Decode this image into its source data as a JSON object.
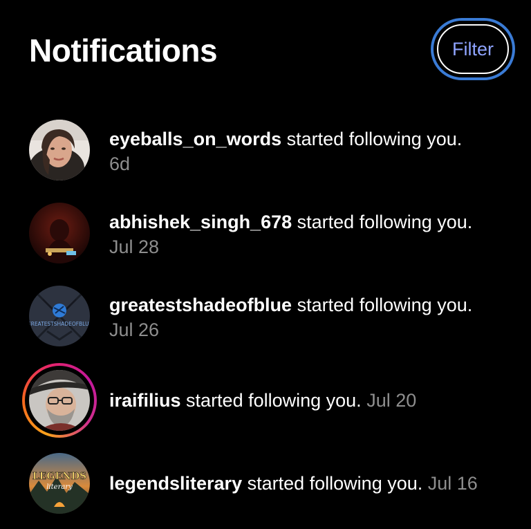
{
  "header": {
    "title": "Notifications",
    "filter_label": "Filter"
  },
  "notifications": [
    {
      "username": "eyeballs_on_words",
      "message": "started following you.",
      "time": "6d",
      "avatar": "woman-portrait-avatar"
    },
    {
      "username": "abhishek_singh_678",
      "message": "started following you.",
      "time": "Jul 28",
      "avatar": "dark-red-scene-avatar"
    },
    {
      "username": "greatestshadeofblue",
      "message": "started following you.",
      "time": "Jul 26",
      "avatar": "greatestshadeofblue-logo-avatar",
      "avatar_text": "GREATESTSHADEOFBLUE"
    },
    {
      "username": "iraifilius",
      "message": "started following you.",
      "time": "Jul 20",
      "avatar": "man-with-hat-avatar",
      "has_story_ring": true
    },
    {
      "username": "legendsliterary",
      "message": "started following you.",
      "time": "Jul 16",
      "avatar": "legends-literary-logo-avatar",
      "avatar_text": [
        "LEGENDS",
        "literary"
      ]
    }
  ],
  "colors": {
    "background": "#000000",
    "filter_text": "#8fa4ff",
    "filter_focus_ring": "#3a7bd5",
    "timestamp": "#8e8e8e"
  }
}
